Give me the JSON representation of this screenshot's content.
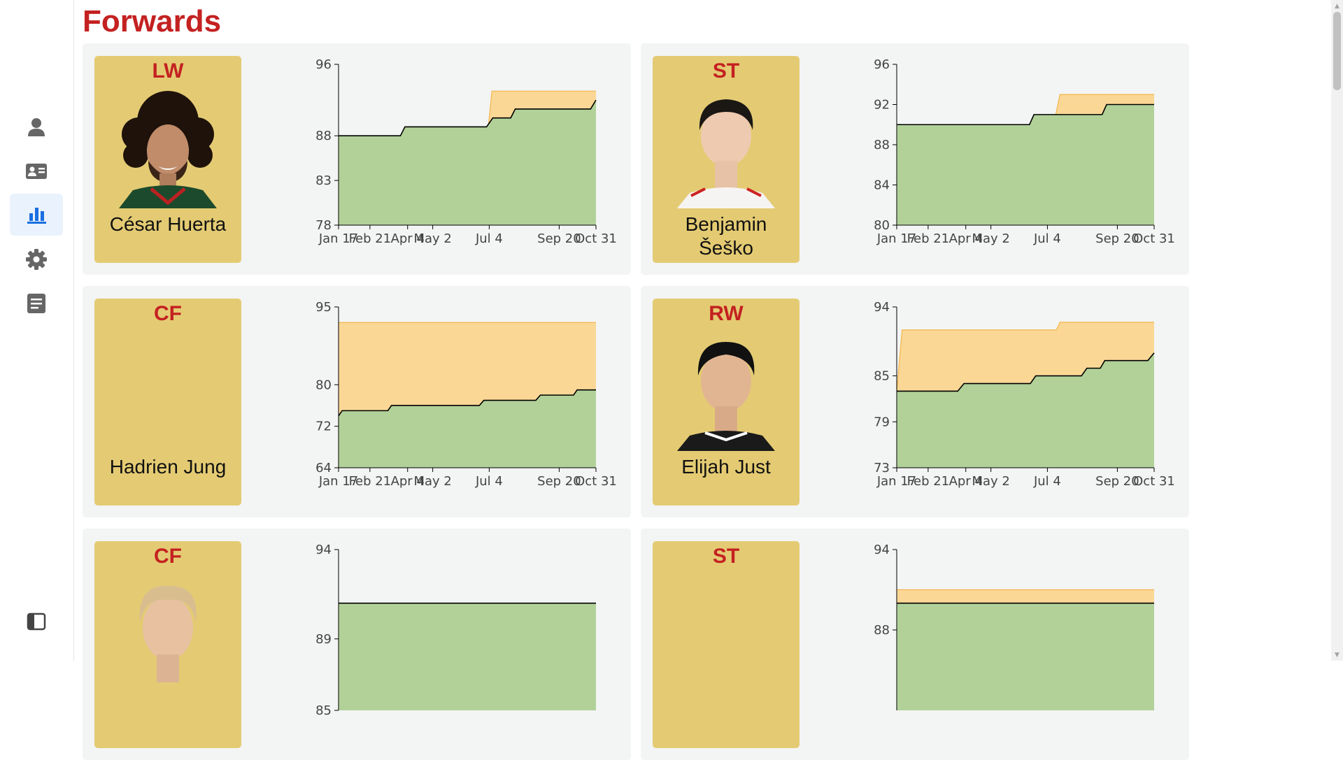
{
  "page": {
    "title": "Forwards"
  },
  "sidebar": {
    "items": [
      {
        "icon": "person-icon",
        "active": false
      },
      {
        "icon": "id-card-icon",
        "active": false
      },
      {
        "icon": "bar-chart-icon",
        "active": true
      },
      {
        "icon": "gear-icon",
        "active": false
      },
      {
        "icon": "document-icon",
        "active": false
      }
    ],
    "bottom_icon": "sidebar-toggle-icon"
  },
  "colors": {
    "title": "#c42121",
    "card_bg": "#f3f4f4",
    "player_box": "#e4cb73",
    "current_fill": "#b1d199",
    "potential_fill": "#fbd796",
    "potential_line": "#f2b64a",
    "current_line": "#000000",
    "sidebar_active": "#1a6fe0"
  },
  "players": [
    {
      "position": "LW",
      "name": "César Huerta",
      "photo": "curly",
      "chart": {
        "y_ticks": [
          96,
          88,
          83,
          78
        ],
        "ylim": [
          78,
          96
        ],
        "x_ticks": [
          "Jan 17",
          "Feb 21",
          "Apr 4",
          "May 2",
          "Jul 4",
          "Sep 20",
          "Oct 31"
        ]
      }
    },
    {
      "position": "ST",
      "name": "Benjamin Šeško",
      "photo": "short-dark",
      "chart": {
        "y_ticks": [
          96,
          92,
          88,
          84,
          80
        ],
        "ylim": [
          80,
          96
        ],
        "x_ticks": [
          "Jan 17",
          "Feb 21",
          "Apr 4",
          "May 2",
          "Jul 4",
          "Sep 20",
          "Oct 31"
        ]
      }
    },
    {
      "position": "CF",
      "name": "Hadrien Jung",
      "photo": "none",
      "chart": {
        "y_ticks": [
          95,
          80,
          72,
          64
        ],
        "ylim": [
          64,
          95
        ],
        "x_ticks": [
          "Jan 17",
          "Feb 21",
          "Apr 4",
          "May 2",
          "Jul 4",
          "Sep 20",
          "Oct 31"
        ]
      }
    },
    {
      "position": "RW",
      "name": "Elijah Just",
      "photo": "young-dark",
      "chart": {
        "y_ticks": [
          94,
          85,
          79,
          73
        ],
        "ylim": [
          73,
          94
        ],
        "x_ticks": [
          "Jan 17",
          "Feb 21",
          "Apr 4",
          "May 2",
          "Jul 4",
          "Sep 20",
          "Oct 31"
        ]
      }
    },
    {
      "position": "CF",
      "name": "",
      "photo": "blond",
      "chart": {
        "y_ticks": [
          94,
          89,
          85
        ],
        "ylim": [
          85,
          94
        ],
        "x_ticks": []
      }
    },
    {
      "position": "ST",
      "name": "",
      "photo": "none",
      "chart": {
        "y_ticks": [
          94,
          88
        ],
        "ylim": [
          82,
          94
        ],
        "x_ticks": []
      }
    }
  ],
  "chart_data": [
    {
      "type": "area",
      "x": [
        "Jan 17",
        "Feb 21",
        "Apr 4",
        "May 2",
        "Jul 4",
        "Sep 20",
        "Oct 31"
      ],
      "x_days": [
        0,
        35,
        77,
        105,
        168,
        246,
        287
      ],
      "ylim": [
        78,
        96
      ],
      "series": [
        {
          "points": [
            [
              0,
              88
            ],
            [
              69,
              88
            ],
            [
              76,
              89
            ],
            [
              167,
              89
            ],
            [
              171,
              93
            ],
            [
              287,
              93
            ]
          ]
        },
        {
          "points": [
            [
              0,
              88
            ],
            [
              69,
              88
            ],
            [
              74,
              89
            ],
            [
              165,
              89
            ],
            [
              172,
              90
            ],
            [
              192,
              90
            ],
            [
              197,
              91
            ],
            [
              281,
              91
            ],
            [
              287,
              92
            ]
          ]
        }
      ]
    },
    {
      "type": "area",
      "x": [
        "Jan 17",
        "Feb 21",
        "Apr 4",
        "May 2",
        "Jul 4",
        "Sep 20",
        "Oct 31"
      ],
      "x_days": [
        0,
        35,
        77,
        105,
        168,
        246,
        287
      ],
      "ylim": [
        80,
        96
      ],
      "series": [
        {
          "points": [
            [
              0,
              90
            ],
            [
              175,
              90
            ],
            [
              182,
              93
            ],
            [
              287,
              93
            ]
          ]
        },
        {
          "points": [
            [
              0,
              90
            ],
            [
              148,
              90
            ],
            [
              153,
              91
            ],
            [
              229,
              91
            ],
            [
              234,
              92
            ],
            [
              287,
              92
            ]
          ]
        }
      ]
    },
    {
      "type": "area",
      "x": [
        "Jan 17",
        "Feb 21",
        "Apr 4",
        "May 2",
        "Jul 4",
        "Sep 20",
        "Oct 31"
      ],
      "x_days": [
        0,
        35,
        77,
        105,
        168,
        246,
        287
      ],
      "ylim": [
        64,
        95
      ],
      "series": [
        {
          "points": [
            [
              0,
              92
            ],
            [
              287,
              92
            ]
          ]
        },
        {
          "points": [
            [
              0,
              74
            ],
            [
              4,
              75
            ],
            [
              55,
              75
            ],
            [
              59,
              76
            ],
            [
              157,
              76
            ],
            [
              162,
              77
            ],
            [
              220,
              77
            ],
            [
              225,
              78
            ],
            [
              262,
              78
            ],
            [
              266,
              79
            ],
            [
              287,
              79
            ]
          ]
        }
      ]
    },
    {
      "type": "area",
      "x": [
        "Jan 17",
        "Feb 21",
        "Apr 4",
        "May 2",
        "Jul 4",
        "Sep 20",
        "Oct 31"
      ],
      "x_days": [
        0,
        35,
        77,
        105,
        168,
        246,
        287
      ],
      "ylim": [
        73,
        94
      ],
      "series": [
        {
          "points": [
            [
              0,
              83
            ],
            [
              6,
              91
            ],
            [
              178,
              91
            ],
            [
              182,
              92
            ],
            [
              287,
              92
            ]
          ]
        },
        {
          "points": [
            [
              0,
              83
            ],
            [
              68,
              83
            ],
            [
              75,
              84
            ],
            [
              149,
              84
            ],
            [
              155,
              85
            ],
            [
              206,
              85
            ],
            [
              212,
              86
            ],
            [
              227,
              86
            ],
            [
              232,
              87
            ],
            [
              280,
              87
            ],
            [
              287,
              88
            ]
          ]
        }
      ]
    },
    {
      "type": "area",
      "x": [],
      "x_days": [
        0,
        287
      ],
      "ylim": [
        85,
        94
      ],
      "series": [
        {
          "points": [
            [
              0,
              91
            ],
            [
              287,
              91
            ]
          ]
        },
        {
          "points": [
            [
              0,
              91
            ],
            [
              287,
              91
            ]
          ]
        }
      ]
    },
    {
      "type": "area",
      "x": [],
      "x_days": [
        0,
        287
      ],
      "ylim": [
        82,
        94
      ],
      "series": [
        {
          "points": [
            [
              0,
              91
            ],
            [
              287,
              91
            ]
          ]
        },
        {
          "points": [
            [
              0,
              90
            ],
            [
              287,
              90
            ]
          ]
        }
      ]
    }
  ]
}
